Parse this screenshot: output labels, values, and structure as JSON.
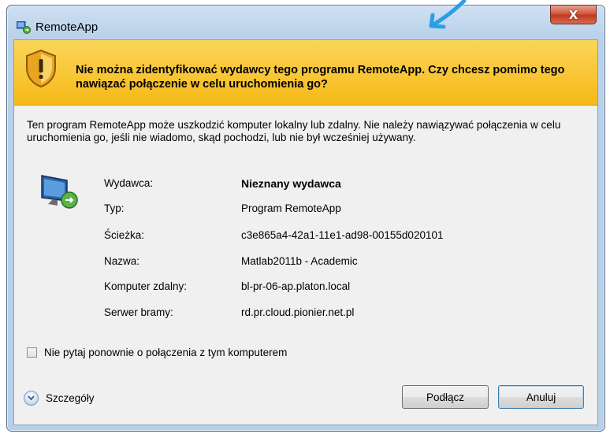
{
  "window": {
    "title": "RemoteApp",
    "close_label": "X"
  },
  "banner": {
    "warning_text": "Nie można zidentyfikować wydawcy tego programu RemoteApp. Czy chcesz pomimo tego nawiązać połączenie w celu uruchomienia go?"
  },
  "description": "Ten program RemoteApp może uszkodzić komputer lokalny lub zdalny. Nie należy nawiązywać połączenia w celu uruchomienia go, jeśli nie wiadomo, skąd pochodzi, lub nie był wcześniej używany.",
  "info": [
    {
      "label": "Wydawca:",
      "value": "Nieznany wydawca"
    },
    {
      "label": "Typ:",
      "value": "Program RemoteApp"
    },
    {
      "label": "Ścieżka:",
      "value": "c3e865a4-42a1-11e1-ad98-00155d020101"
    },
    {
      "label": "Nazwa:",
      "value": "Matlab2011b - Academic"
    },
    {
      "label": "Komputer zdalny:",
      "value": "bl-pr-06-ap.platon.local"
    },
    {
      "label": "Serwer bramy:",
      "value": "rd.pr.cloud.pionier.net.pl"
    }
  ],
  "checkbox": {
    "label": "Nie pytaj ponownie o połączenia z tym komputerem",
    "checked": false
  },
  "details": {
    "label": "Szczegóły"
  },
  "buttons": {
    "connect": "Podłącz",
    "cancel": "Anuluj"
  },
  "colors": {
    "banner": "#f6b917",
    "close_button": "#c8462c",
    "annotation_stroke": "#2b9fe6"
  }
}
